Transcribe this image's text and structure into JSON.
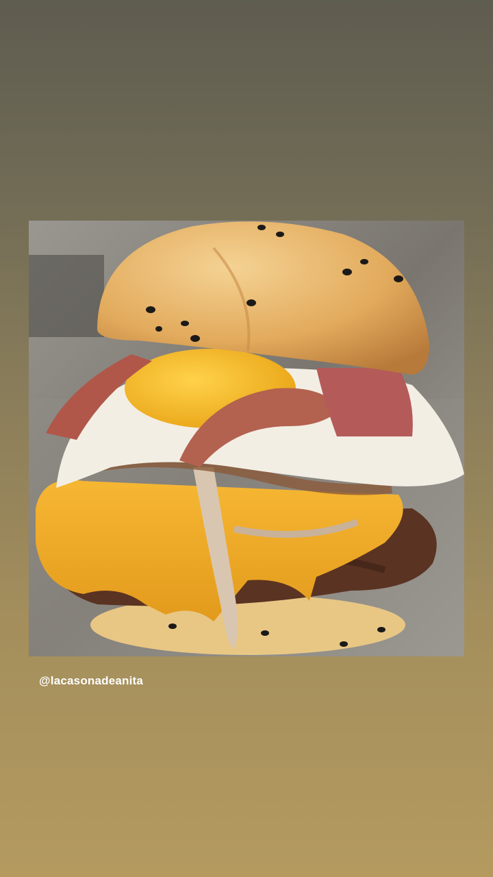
{
  "story": {
    "photo": {
      "subject": "burger-photo",
      "colors": {
        "background": "#8a8782",
        "bun": "#e0a85a",
        "bun_highlight": "#f2cc8a",
        "egg_white": "#f3eee4",
        "yolk": "#f5b81c",
        "bacon": "#b0574a",
        "cheese": "#f2a925",
        "patty": "#5a3322",
        "onion": "#d9c6b0",
        "seed": "#1c1a18"
      }
    },
    "mention": "@lacasonadeanita"
  }
}
